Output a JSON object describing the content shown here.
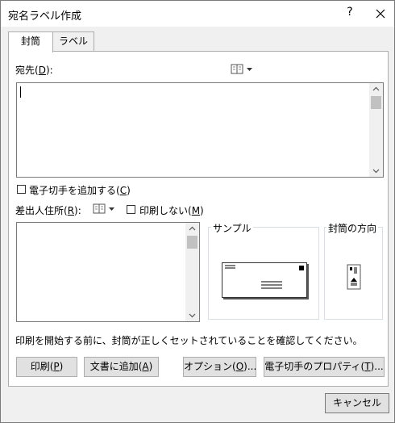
{
  "window": {
    "title": "宛名ラベル作成",
    "help_label": "?"
  },
  "tabs": [
    {
      "label": "封筒",
      "active": true
    },
    {
      "label": "ラベル",
      "active": false
    }
  ],
  "address": {
    "label": "宛先(",
    "accel": "D",
    "label_end": "):",
    "value": ""
  },
  "epostage": {
    "label": "電子切手を追加する(",
    "accel": "C",
    "label_end": ")",
    "checked": false
  },
  "return_address": {
    "label": "差出人住所(",
    "accel": "R",
    "label_end": "):",
    "value": ""
  },
  "omit": {
    "label": "印刷しない(",
    "accel": "M",
    "label_end": ")",
    "checked": false
  },
  "preview": {
    "title": "サンプル"
  },
  "feed": {
    "title": "封筒の方向"
  },
  "status_text": "印刷を開始する前に、封筒が正しくセットされていることを確認してください。",
  "buttons": {
    "print": {
      "label": "印刷(",
      "accel": "P",
      "label_end": ")"
    },
    "add_to_doc": {
      "label": "文書に追加(",
      "accel": "A",
      "label_end": ")"
    },
    "options": {
      "label": "オプション(",
      "accel": "O",
      "label_end": ")..."
    },
    "epostage_props": {
      "label": "電子切手のプロパティ(",
      "accel": "T",
      "label_end": ")..."
    },
    "cancel": {
      "label": "キャンセル"
    }
  }
}
